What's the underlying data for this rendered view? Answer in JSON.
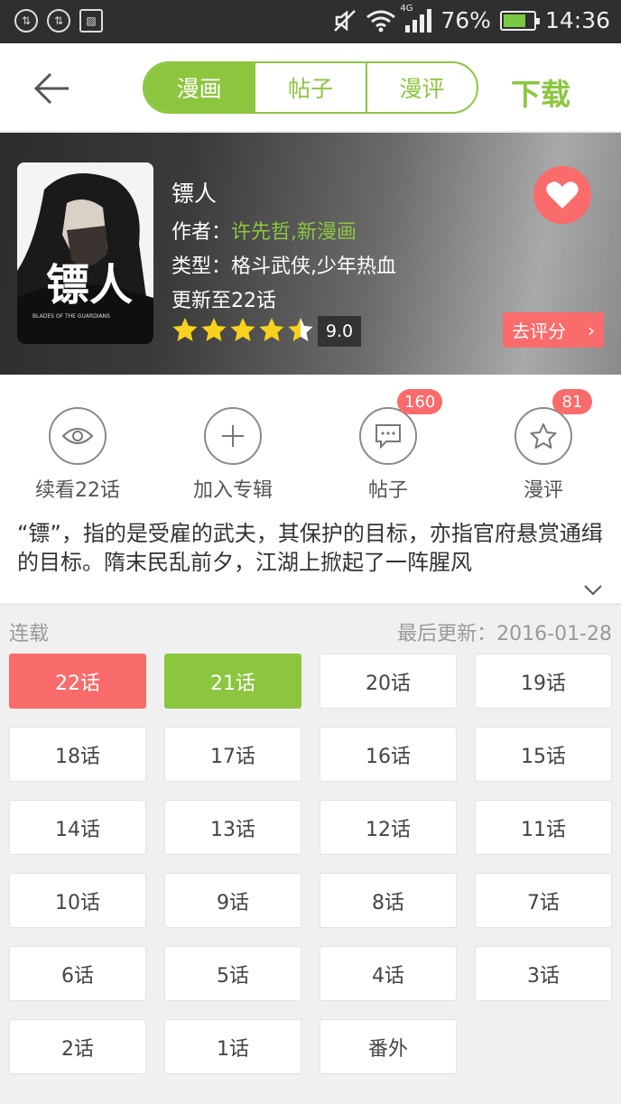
{
  "status_bar": {
    "battery": "76%",
    "battery_level": 0.76,
    "time": "14:36",
    "network": "4G",
    "icons": [
      "sync-icon",
      "sync-icon",
      "image-icon",
      "mute-icon",
      "wifi-icon",
      "signal-icon",
      "battery-icon"
    ]
  },
  "header": {
    "tabs": [
      {
        "label": "漫画",
        "active": true
      },
      {
        "label": "帖子",
        "active": false
      },
      {
        "label": "漫评",
        "active": false
      }
    ],
    "download_label": "下载"
  },
  "comic": {
    "title": "镖人",
    "author_prefix": "作者：",
    "author": "许先哲,新漫画",
    "genre": "类型：格斗武侠,少年热血",
    "update": "更新至22话",
    "rating_stars": 4.5,
    "score": "9.0",
    "rate_button": "去评分",
    "cover_title": "镖人",
    "cover_subtitle": "BLADES OF THE GUARDIANS"
  },
  "actions": [
    {
      "label": "续看22话",
      "icon": "eye-icon"
    },
    {
      "label": "加入专辑",
      "icon": "plus-icon"
    },
    {
      "label": "帖子",
      "icon": "comment-icon",
      "badge": "160"
    },
    {
      "label": "漫评",
      "icon": "star-icon",
      "badge": "81"
    }
  ],
  "description": "“镖”，指的是受雇的武夫，其保护的目标，亦指官府悬赏通缉的目标。隋末民乱前夕，江湖上掀起了一阵腥风",
  "chapters": {
    "status": "连载",
    "last_updated": "最后更新：2016-01-28",
    "items": [
      {
        "label": "22话",
        "state": "current"
      },
      {
        "label": "21话",
        "state": "read"
      },
      {
        "label": "20话",
        "state": ""
      },
      {
        "label": "19话",
        "state": ""
      },
      {
        "label": "18话",
        "state": ""
      },
      {
        "label": "17话",
        "state": ""
      },
      {
        "label": "16话",
        "state": ""
      },
      {
        "label": "15话",
        "state": ""
      },
      {
        "label": "14话",
        "state": ""
      },
      {
        "label": "13话",
        "state": ""
      },
      {
        "label": "12话",
        "state": ""
      },
      {
        "label": "11话",
        "state": ""
      },
      {
        "label": "10话",
        "state": ""
      },
      {
        "label": "9话",
        "state": ""
      },
      {
        "label": "8话",
        "state": ""
      },
      {
        "label": "7话",
        "state": ""
      },
      {
        "label": "6话",
        "state": ""
      },
      {
        "label": "5话",
        "state": ""
      },
      {
        "label": "4话",
        "state": ""
      },
      {
        "label": "3话",
        "state": ""
      },
      {
        "label": "2话",
        "state": ""
      },
      {
        "label": "1话",
        "state": ""
      },
      {
        "label": "番外",
        "state": ""
      }
    ]
  },
  "colors": {
    "accent_green": "#8cc63f",
    "accent_red": "#fa6b6b",
    "star": "#f7d11c"
  }
}
